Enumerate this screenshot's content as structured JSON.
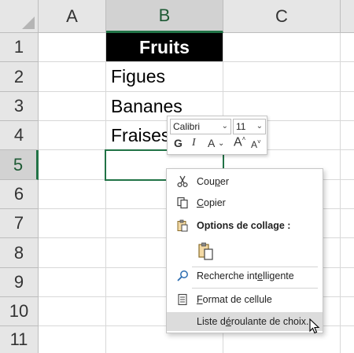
{
  "columns": [
    "A",
    "B",
    "C"
  ],
  "rows": [
    "1",
    "2",
    "3",
    "4",
    "5",
    "6",
    "7",
    "8",
    "9",
    "10",
    "11"
  ],
  "cells": {
    "b1": "Fruits",
    "b2": "Figues",
    "b3": "Bananes",
    "b4": "Fraises"
  },
  "mini_toolbar": {
    "font_name": "Calibri",
    "font_size": "11",
    "bold": "G",
    "italic": "I",
    "font_color": "A",
    "grow": "A",
    "shrink": "A"
  },
  "context_menu": {
    "cut": {
      "pre": "Cou",
      "key": "p",
      "post": "er"
    },
    "copy": {
      "pre": "",
      "key": "C",
      "post": "opier"
    },
    "paste_options": "Options de collage :",
    "smart_lookup": {
      "pre": "Recherche int",
      "key": "e",
      "post": "lligente"
    },
    "format_cells": {
      "pre": "",
      "key": "F",
      "post": "ormat de cellule"
    },
    "dropdown_list": {
      "pre": "Liste d",
      "key": "é",
      "post": "roulante de choix..."
    }
  },
  "colors": {
    "accent_green": "#217346",
    "header_fill": "#000000",
    "highlight": "#dcdcdc"
  },
  "icons": [
    "scissors-icon",
    "copy-icon",
    "paste-clipboard-icon",
    "paste-option-icon",
    "search-icon",
    "format-cells-icon",
    "mouse-pointer-icon"
  ]
}
